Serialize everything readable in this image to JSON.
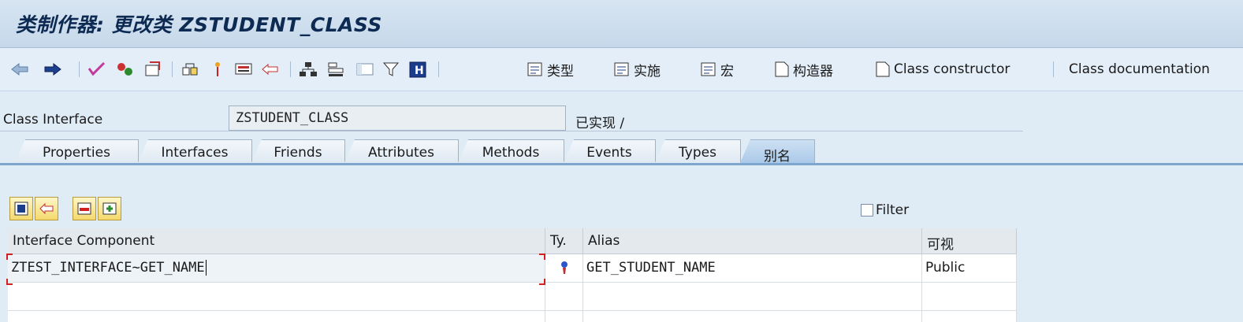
{
  "window": {
    "title": "类制作器: 更改类 ZSTUDENT_CLASS"
  },
  "toolbar": {
    "types_label": "类型",
    "impl_label": "实施",
    "macro_label": "宏",
    "constructor_label": "构造器",
    "class_constructor_label": "Class constructor",
    "class_documentation_label": "Class documentation"
  },
  "header": {
    "class_interface_label": "Class Interface",
    "class_interface_value": "ZSTUDENT_CLASS",
    "status": "已实现 /"
  },
  "tabs": [
    {
      "label": "Properties"
    },
    {
      "label": "Interfaces"
    },
    {
      "label": "Friends"
    },
    {
      "label": "Attributes"
    },
    {
      "label": "Methods"
    },
    {
      "label": "Events"
    },
    {
      "label": "Types"
    },
    {
      "label": "别名",
      "active": true
    }
  ],
  "filter": {
    "label": "Filter",
    "checked": false
  },
  "table": {
    "columns": [
      "Interface Component",
      "Ty.",
      "Alias",
      "可视"
    ],
    "rows": [
      {
        "component": "ZTEST_INTERFACE~GET_NAME",
        "type_icon": "method-icon",
        "alias": "GET_STUDENT_NAME",
        "visibility": "Public"
      }
    ]
  },
  "colors": {
    "accent": "#7fa6cf",
    "title": "#0d2a52",
    "button": "#f4d96c"
  }
}
